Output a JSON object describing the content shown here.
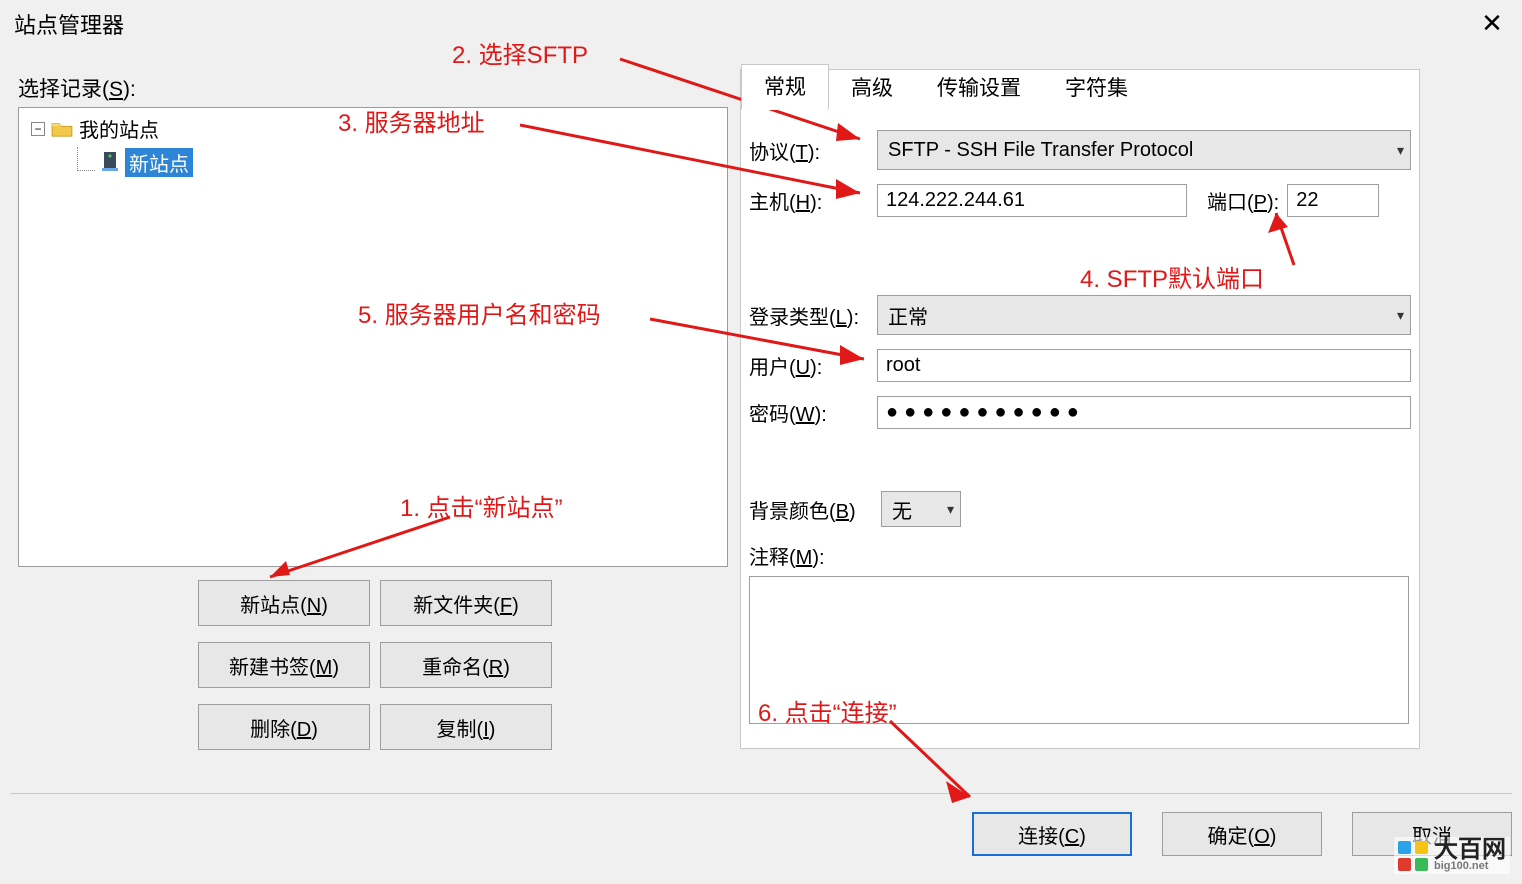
{
  "window": {
    "title": "站点管理器"
  },
  "left": {
    "select_label_left": "选择记录(",
    "select_label_mnemonic": "S",
    "select_label_right": "):",
    "root_item": "我的站点",
    "selected_item": "新站点",
    "expander": "−",
    "buttons": {
      "new_site_l": "新站点(",
      "new_site_m": "N",
      "new_site_r": ")",
      "new_folder_l": "新文件夹(",
      "new_folder_m": "F",
      "new_folder_r": ")",
      "new_bookmark_l": "新建书签(",
      "new_bookmark_m": "M",
      "new_bookmark_r": ")",
      "rename_l": "重命名(",
      "rename_m": "R",
      "rename_r": ")",
      "delete_l": "删除(",
      "delete_m": "D",
      "delete_r": ")",
      "copy_l": "复制(",
      "copy_m": "I",
      "copy_r": ")"
    }
  },
  "tabs": [
    "常规",
    "高级",
    "传输设置",
    "字符集"
  ],
  "form": {
    "protocol_label_l": "协议(",
    "protocol_label_m": "T",
    "protocol_label_r": "):",
    "protocol_value": "SFTP - SSH File Transfer Protocol",
    "host_label_l": "主机(",
    "host_label_m": "H",
    "host_label_r": "):",
    "host_value": "124.222.244.61",
    "port_label_l": "端口(",
    "port_label_m": "P",
    "port_label_r": "):",
    "port_value": "22",
    "logon_label_l": "登录类型(",
    "logon_label_m": "L",
    "logon_label_r": "):",
    "logon_value": "正常",
    "user_label_l": "用户(",
    "user_label_m": "U",
    "user_label_r": "):",
    "user_value": "root",
    "pass_label_l": "密码(",
    "pass_label_m": "W",
    "pass_label_r": "):",
    "pass_mask": "●●●●●●●●●●●",
    "bg_label_l": "背景颜色(",
    "bg_label_m": "B",
    "bg_label_r": ")",
    "bg_value": "无",
    "notes_label_l": "注释(",
    "notes_label_m": "M",
    "notes_label_r": "):"
  },
  "bottom": {
    "connect_l": "连接(",
    "connect_m": "C",
    "connect_r": ")",
    "ok_l": "确定(",
    "ok_m": "O",
    "ok_r": ")",
    "cancel": "取消"
  },
  "annotations": {
    "a1": "1. 点击“新站点”",
    "a2": "2. 选择SFTP",
    "a3": "3. 服务器地址",
    "a4": "4. SFTP默认端口",
    "a5": "5. 服务器用户名和密码",
    "a6": "6. 点击“连接”"
  },
  "watermark": {
    "cn": "大百网",
    "en": "big100.net"
  }
}
